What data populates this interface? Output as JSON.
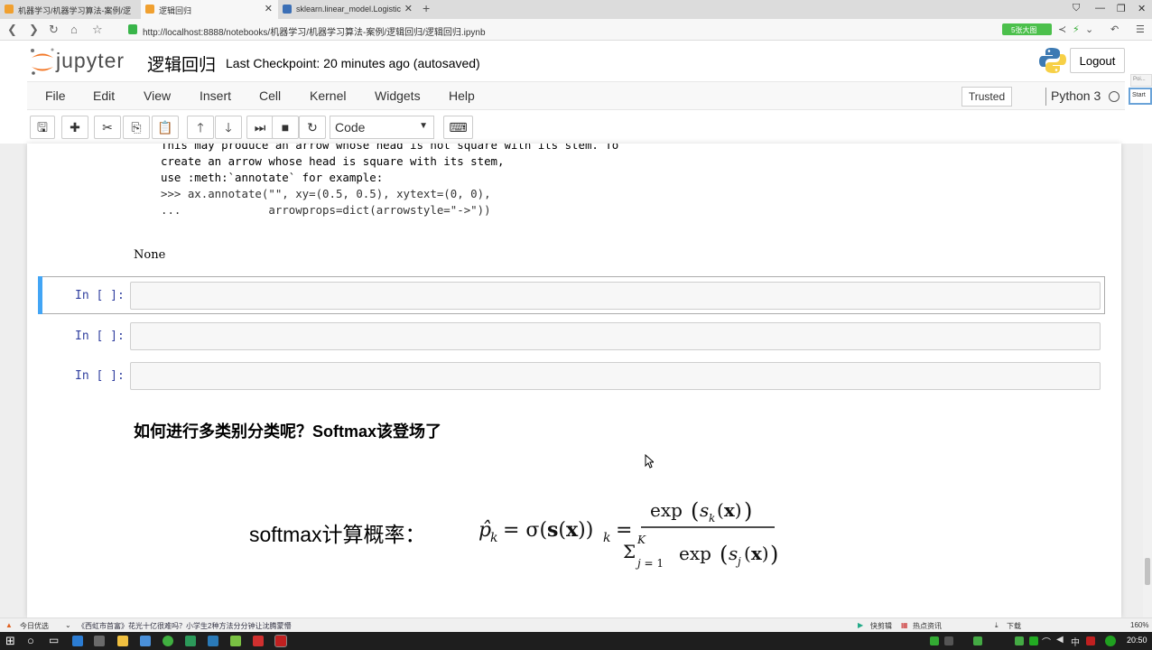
{
  "browser": {
    "tabs": [
      {
        "label": "机器学习/机器学习算法-案例/逻",
        "color": "#f0a030",
        "active": false
      },
      {
        "label": "逻辑回归",
        "color": "#f0a030",
        "active": true
      },
      {
        "label": "sklearn.linear_model.Logistic",
        "color": "#3b6fb6",
        "active": false
      }
    ],
    "new_tab": "+",
    "url_host": "http://localhost:8888/notebooks/机器学习/机器学习算法-案例/逻辑回归/逻辑回归.ipynb",
    "zoom_badge": "5张大图",
    "close_glyph": "✕"
  },
  "header": {
    "logo_text": "jupyter",
    "notebook_name": "逻辑回归",
    "checkpoint": "Last Checkpoint: 20 minutes ago (autosaved)",
    "logout_label": "Logout",
    "side_box": "Poi..."
  },
  "menubar": {
    "items": [
      "File",
      "Edit",
      "View",
      "Insert",
      "Cell",
      "Kernel",
      "Widgets",
      "Help"
    ],
    "trusted": "Trusted",
    "kernel": "Python 3",
    "start": "Start"
  },
  "toolbar": {
    "icons": [
      "save-icon",
      "plus-icon",
      "cut-icon",
      "copy-icon",
      "paste-icon",
      "arrow-up-icon",
      "arrow-down-icon",
      "run-icon",
      "stop-icon",
      "restart-icon"
    ],
    "glyphs": [
      "🖫",
      "✚",
      "✂",
      "⎘",
      "📋",
      "🡑",
      "🡓",
      "⏭",
      "■",
      "↻"
    ],
    "cell_type": "Code",
    "keyboard_glyph": "⌨"
  },
  "notebook": {
    "output_lines": [
      "This may produce an arrow whose head is not square with its stem. To",
      "create an arrow whose head is square with its stem,",
      "use :meth:`annotate` for example:",
      "",
      ">>> ax.annotate(\"\", xy=(0.5, 0.5), xytext=(0, 0),",
      "...             arrowprops=dict(arrowstyle=\"->\"))"
    ],
    "output_none": "None",
    "cells": [
      {
        "prompt": "In [ ]:",
        "selected": true
      },
      {
        "prompt": "In [ ]:",
        "selected": false
      },
      {
        "prompt": "In [ ]:",
        "selected": false
      }
    ],
    "md_heading": "如何进行多类别分类呢？Softmax该登场了",
    "formula_label": "softmax计算概率："
  },
  "statusbar": {
    "left": "今日优选",
    "news": "《西虹市首富》花光十亿很难吗？小学生2种方法分分钟让沈腾蒙懵",
    "right_items": [
      "快剪辑",
      "热点资讯",
      "下载"
    ],
    "zoom": "160%"
  },
  "taskbar": {
    "ime": "中",
    "clock": "20:50"
  },
  "colors": {
    "prompt_in": "#303f9f",
    "selected_bar": "#42a5f5",
    "jupyter_orange": "#f37726"
  }
}
